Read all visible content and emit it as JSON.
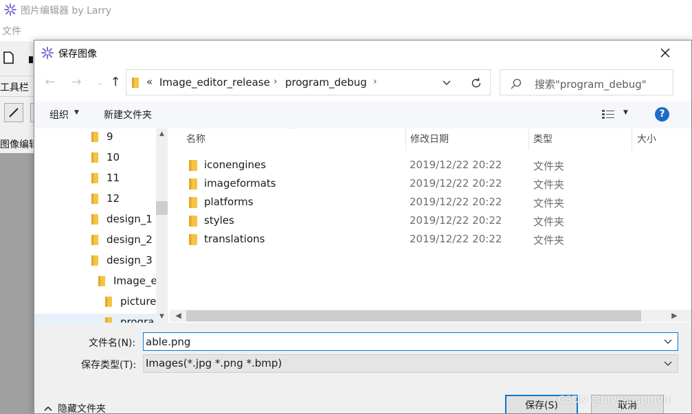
{
  "app": {
    "title": "图片编辑器 by Larry",
    "menu_file": "文件",
    "toolbar_label": "工具栏",
    "editor_label": "图像编辑"
  },
  "dialog": {
    "title": "保存图像",
    "address": {
      "overflow": "«",
      "crumbs": [
        "Image_editor_release",
        "program_debug"
      ],
      "separator": "›"
    },
    "search_placeholder": "搜索\"program_debug\"",
    "commands": {
      "organize": "组织",
      "new_folder": "新建文件夹"
    },
    "tree": {
      "items": [
        {
          "label": "9"
        },
        {
          "label": "10"
        },
        {
          "label": "11"
        },
        {
          "label": "12"
        },
        {
          "label": "design_1"
        },
        {
          "label": "design_2"
        },
        {
          "label": "design_3"
        },
        {
          "label": "Image_e"
        },
        {
          "label": "picture"
        },
        {
          "label": "progra"
        }
      ]
    },
    "columns": {
      "name": "名称",
      "modified": "修改日期",
      "type": "类型",
      "size": "大小"
    },
    "files": [
      {
        "name": "iconengines",
        "modified": "2019/12/22 20:22",
        "type": "文件夹"
      },
      {
        "name": "imageformats",
        "modified": "2019/12/22 20:22",
        "type": "文件夹"
      },
      {
        "name": "platforms",
        "modified": "2019/12/22 20:22",
        "type": "文件夹"
      },
      {
        "name": "styles",
        "modified": "2019/12/22 20:22",
        "type": "文件夹"
      },
      {
        "name": "translations",
        "modified": "2019/12/22 20:22",
        "type": "文件夹"
      }
    ],
    "form": {
      "filename_label": "文件名(N):",
      "filename_value": "able.png",
      "filetype_label": "保存类型(T):",
      "filetype_value": "Images(*.jpg *.png *.bmp)",
      "hide_folders": "隐藏文件夹",
      "save": "保存(S)",
      "cancel": "取消"
    }
  },
  "watermark": "CSDN @biyezuopinvip",
  "colors": {
    "accent": "#0078d7",
    "folder": "#f5c445",
    "help": "#1f6cc4",
    "selection": "#e5f1fb"
  }
}
